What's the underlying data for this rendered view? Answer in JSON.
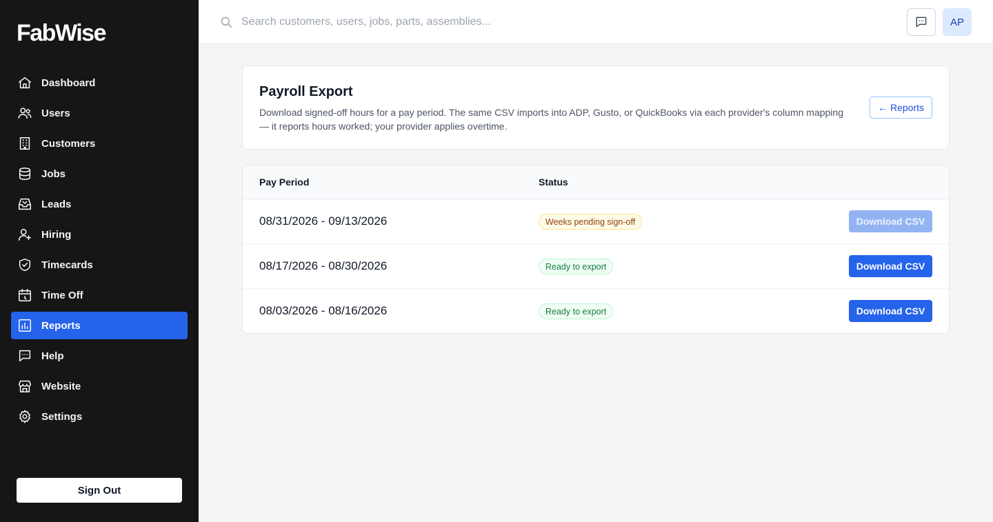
{
  "app": {
    "logo": "FabWise"
  },
  "sidebar": {
    "items": [
      {
        "label": "Dashboard",
        "icon": "home-icon"
      },
      {
        "label": "Users",
        "icon": "users-icon"
      },
      {
        "label": "Customers",
        "icon": "building-icon"
      },
      {
        "label": "Jobs",
        "icon": "database-icon"
      },
      {
        "label": "Leads",
        "icon": "inbox-icon"
      },
      {
        "label": "Hiring",
        "icon": "user-plus-icon"
      },
      {
        "label": "Timecards",
        "icon": "shield-check-icon"
      },
      {
        "label": "Time Off",
        "icon": "calendar-icon"
      },
      {
        "label": "Reports",
        "icon": "chart-icon",
        "active": true
      },
      {
        "label": "Help",
        "icon": "message-icon"
      },
      {
        "label": "Website",
        "icon": "store-icon"
      },
      {
        "label": "Settings",
        "icon": "gear-icon"
      }
    ],
    "sign_out": "Sign Out"
  },
  "topbar": {
    "search_placeholder": "Search customers, users, jobs, parts, assemblies...",
    "avatar_initials": "AP"
  },
  "page": {
    "title": "Payroll Export",
    "description": "Download signed-off hours for a pay period. The same CSV imports into ADP, Gusto, or QuickBooks via each provider's column mapping — it reports hours worked; your provider applies overtime.",
    "back_arrow": "←",
    "back_label": "Reports"
  },
  "table": {
    "headers": {
      "period": "Pay Period",
      "status": "Status"
    },
    "rows": [
      {
        "period": "08/31/2026 - 09/13/2026",
        "status": "Weeks pending sign-off",
        "status_type": "pending",
        "action": "Download CSV",
        "enabled": false
      },
      {
        "period": "08/17/2026 - 08/30/2026",
        "status": "Ready to export",
        "status_type": "ready",
        "action": "Download CSV",
        "enabled": true
      },
      {
        "period": "08/03/2026 - 08/16/2026",
        "status": "Ready to export",
        "status_type": "ready",
        "action": "Download CSV",
        "enabled": true
      }
    ]
  },
  "colors": {
    "sidebar_bg": "#161616",
    "accent": "#2563eb",
    "pending": "#92400e",
    "ready": "#15803d"
  }
}
